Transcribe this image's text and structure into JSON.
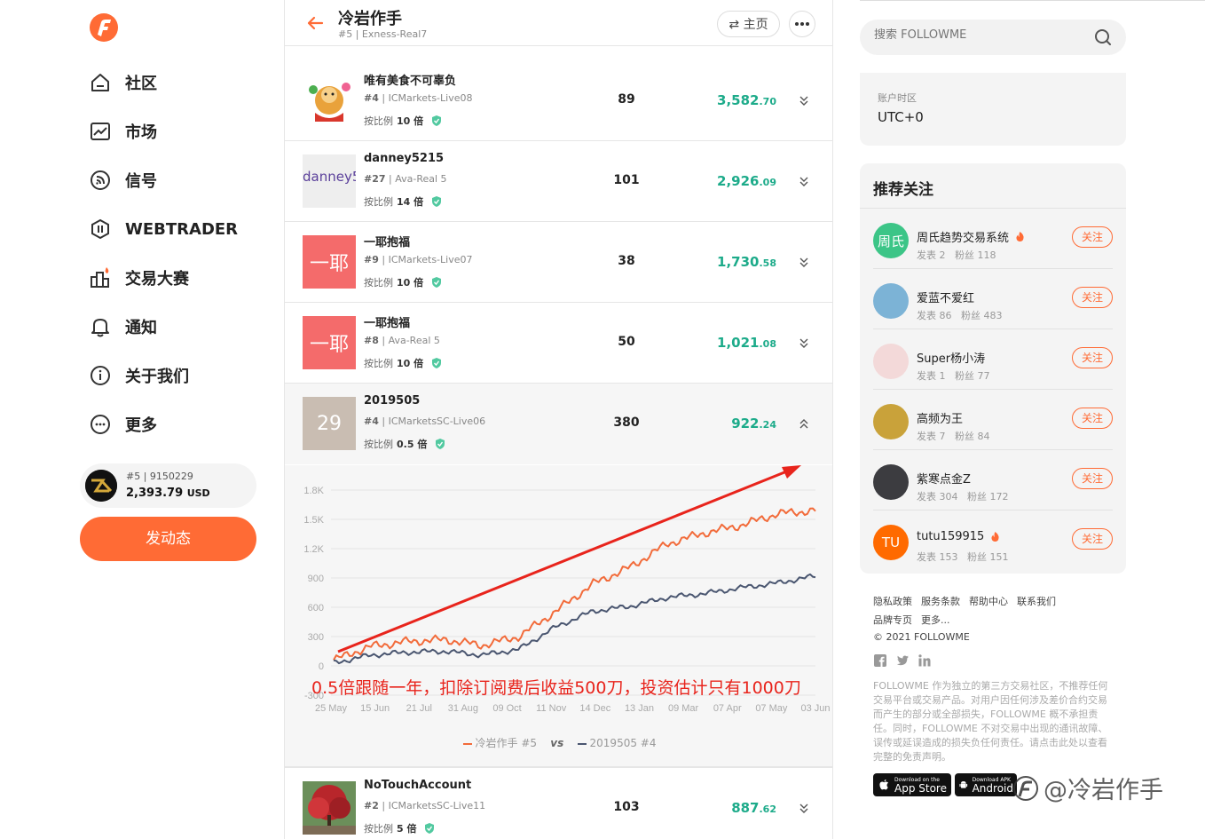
{
  "sidebar": {
    "nav": [
      {
        "label": "社区",
        "icon": "home-icon"
      },
      {
        "label": "市场",
        "icon": "chart-icon"
      },
      {
        "label": "信号",
        "icon": "signal-icon"
      },
      {
        "label": "WEBTRADER",
        "icon": "webtrader-icon"
      },
      {
        "label": "交易大赛",
        "icon": "contest-icon"
      },
      {
        "label": "通知",
        "icon": "bell-icon"
      },
      {
        "label": "关于我们",
        "icon": "info-icon"
      },
      {
        "label": "更多",
        "icon": "more-icon"
      }
    ],
    "account": {
      "rank": "#5",
      "id": "9150229",
      "balance": "2,393.79",
      "currency": "USD"
    },
    "post_button": "发动态"
  },
  "header": {
    "title": "冷岩作手",
    "rank": "#5",
    "account": "Exness-Real7",
    "home_button": "⇄ 主页"
  },
  "rows": [
    {
      "name": "唯有美食不可辜负",
      "rank": "#4",
      "server": "ICMarkets-Live08",
      "ratio_label": "按比例",
      "ratio": "10 倍",
      "count": "89",
      "profit_int": "3,582",
      "profit_dec": ".70",
      "avatar": "image"
    },
    {
      "name": "danney5215",
      "rank": "#27",
      "server": "Ava-Real 5",
      "ratio_label": "按比例",
      "ratio": "14 倍",
      "count": "101",
      "profit_int": "2,926",
      "profit_dec": ".09",
      "avatar_text": "danney5"
    },
    {
      "name": "一耶抱福",
      "rank": "#9",
      "server": "ICMarkets-Live07",
      "ratio_label": "按比例",
      "ratio": "10 倍",
      "count": "38",
      "profit_int": "1,730",
      "profit_dec": ".58",
      "avatar_text": "一耶"
    },
    {
      "name": "一耶抱福",
      "rank": "#8",
      "server": "Ava-Real 5",
      "ratio_label": "按比例",
      "ratio": "10 倍",
      "count": "50",
      "profit_int": "1,021",
      "profit_dec": ".08",
      "avatar_text": "一耶"
    },
    {
      "name": "2019505",
      "rank": "#4",
      "server": "ICMarketsSC-Live06",
      "ratio_label": "按比例",
      "ratio": "0.5 倍",
      "count": "380",
      "profit_int": "922",
      "profit_dec": ".24",
      "avatar_text": "29"
    },
    {
      "name": "NoTouchAccount",
      "rank": "#2",
      "server": "ICMarketsSC-Live11",
      "ratio_label": "按比例",
      "ratio": "5 倍",
      "count": "103",
      "profit_int": "887",
      "profit_dec": ".62",
      "avatar": "image"
    }
  ],
  "chart_data": {
    "type": "line",
    "x": [
      "25 May",
      "15 Jun",
      "21 Jul",
      "31 Aug",
      "09 Oct",
      "11 Nov",
      "14 Dec",
      "13 Jan",
      "09 Mar",
      "07 Apr",
      "07 May",
      "03 Jun"
    ],
    "yticks": [
      "1.8K",
      "1.5K",
      "1.2K",
      "900",
      "600",
      "300",
      "0",
      "-300"
    ],
    "ylim": [
      -300,
      1800
    ],
    "series": [
      {
        "name": "冷岩作手 #5",
        "color": "#f26b3a",
        "values": [
          60,
          200,
          250,
          270,
          210,
          300,
          560,
          840,
          1010,
          1250,
          1360,
          1440,
          1560,
          1590
        ]
      },
      {
        "name": "2019505 #4",
        "color": "#4a5670",
        "values": [
          30,
          110,
          140,
          150,
          110,
          170,
          400,
          560,
          610,
          700,
          740,
          800,
          850,
          920
        ]
      }
    ],
    "vs_label": "vs",
    "annotation": "0.5倍跟随一年，扣除订阅费后收益500刀，投资估计只有1000刀"
  },
  "search": {
    "placeholder": "搜索 FOLLOWME"
  },
  "timezone": {
    "label": "账户时区",
    "value": "UTC+0"
  },
  "recommend": {
    "title": "推荐关注",
    "follow_label": "关注",
    "items": [
      {
        "name": "周氏趋势交易系统",
        "posts": "发表 2",
        "fans": "粉丝 118",
        "avatar_text": "周氏",
        "avatar_color": "#3cc587",
        "fire": true
      },
      {
        "name": "爱蓝不爱红",
        "posts": "发表 86",
        "fans": "粉丝 483",
        "avatar_text": "",
        "avatar_color": "#7cb3d6",
        "fire": false
      },
      {
        "name": "Super杨小涛",
        "posts": "发表 1",
        "fans": "粉丝 77",
        "avatar_text": "",
        "avatar_color": "#f3d9d9",
        "fire": false
      },
      {
        "name": "高频为王",
        "posts": "发表 7",
        "fans": "粉丝 84",
        "avatar_text": "",
        "avatar_color": "#c9a23a",
        "fire": false
      },
      {
        "name": "紫寒点金Z",
        "posts": "发表 304",
        "fans": "粉丝 172",
        "avatar_text": "",
        "avatar_color": "#3c3c40",
        "fire": false
      },
      {
        "name": "tutu159915",
        "posts": "发表 153",
        "fans": "粉丝 151",
        "avatar_text": "TU",
        "avatar_color": "#ff6a00",
        "fire": true
      }
    ]
  },
  "footer": {
    "links": [
      "隐私政策",
      "服务条款",
      "帮助中心",
      "联系我们",
      "品牌专页",
      "更多..."
    ],
    "copyright": "© 2021 FOLLOWME",
    "disclaimer": "FOLLOWME 作为独立的第三方交易社区，不推荐任何交易平台或交易产品。对用户因任何涉及差价合约交易而产生的部分或全部损失，FOLLOWME 概不承担责任。同时，FOLLOWME 不对交易中出现的通讯故障、误传或延误造成的损失负任何责任。请点击此处以查看完整的免责声明。",
    "appstore_small": "Download on the",
    "appstore_big": "App Store",
    "android_small": "Download APK",
    "android_big": "Android",
    "watermark": "@冷岩作手"
  }
}
